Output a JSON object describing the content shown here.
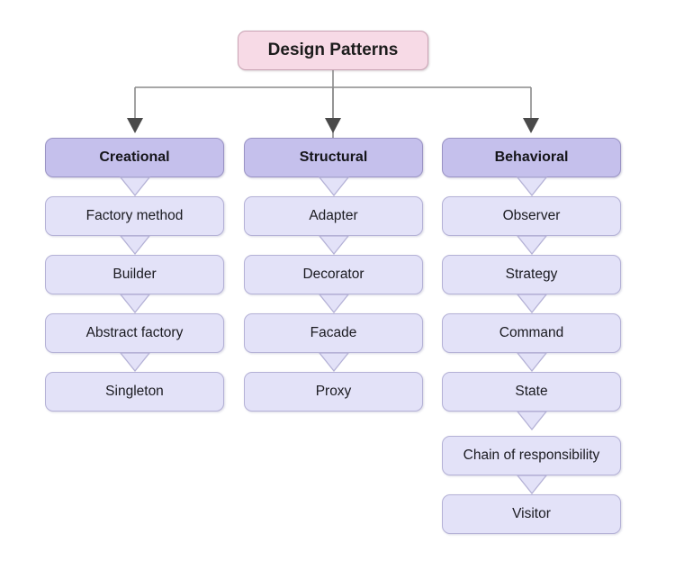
{
  "diagram": {
    "title": "Design Patterns",
    "type": "hierarchy-tree",
    "background_color": "#ffffff",
    "colors": {
      "root_fill": "#f7dae6",
      "root_border": "#c9a3b4",
      "category_fill": "#c5c0ec",
      "category_border": "#9a93c4",
      "pattern_fill": "#e3e2f8",
      "pattern_border": "#b4b1d6",
      "connector_line": "#8a8a8a",
      "arrowhead": "#4a4a4a",
      "text": "#1a1a20"
    },
    "root": {
      "label": "Design Patterns"
    },
    "columns": [
      {
        "id": "creational",
        "header": "Creational",
        "items": [
          {
            "label": "Factory method"
          },
          {
            "label": "Builder"
          },
          {
            "label": "Abstract factory"
          },
          {
            "label": "Singleton"
          }
        ]
      },
      {
        "id": "structural",
        "header": "Structural",
        "items": [
          {
            "label": "Adapter"
          },
          {
            "label": "Decorator"
          },
          {
            "label": "Facade"
          },
          {
            "label": "Proxy"
          }
        ]
      },
      {
        "id": "behavioral",
        "header": "Behavioral",
        "items": [
          {
            "label": "Observer"
          },
          {
            "label": "Strategy"
          },
          {
            "label": "Command"
          },
          {
            "label": "State"
          },
          {
            "label": "Chain of responsibility"
          },
          {
            "label": "Visitor"
          }
        ]
      }
    ]
  }
}
